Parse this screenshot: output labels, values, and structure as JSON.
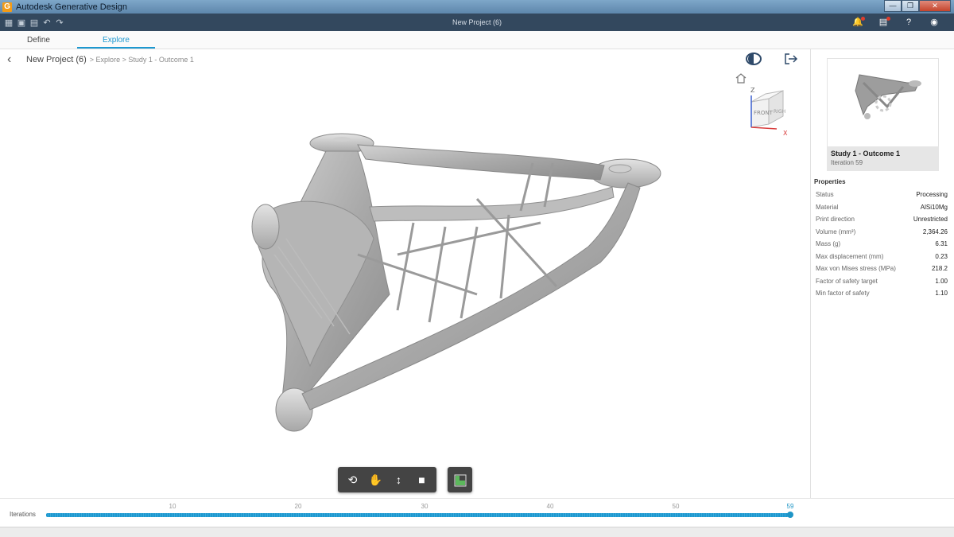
{
  "window": {
    "app_icon_letter": "G",
    "title": "Autodesk Generative Design",
    "minimize": "—",
    "maximize": "❐",
    "close": "✕"
  },
  "appbar": {
    "center_title": "New Project (6)",
    "tools": [
      "grid-icon",
      "save-icon",
      "save-as-icon",
      "undo-icon",
      "redo-icon"
    ],
    "right_icons": [
      "notifications-icon",
      "jobs-icon",
      "help-icon",
      "account-icon"
    ]
  },
  "tabs": [
    {
      "label": "Define",
      "active": false
    },
    {
      "label": "Explore",
      "active": true
    }
  ],
  "breadcrumb": {
    "project": "New Project (6)",
    "path": "> Explore > Study 1 - Outcome 1"
  },
  "viewcube": {
    "z": "Z",
    "x": "X",
    "front": "FRONT",
    "right": "RIGH"
  },
  "panel": {
    "outcome_title": "Study 1 - Outcome 1",
    "outcome_iteration": "Iteration 59",
    "properties_heading": "Properties",
    "properties": [
      {
        "label": "Status",
        "value": "Processing"
      },
      {
        "label": "Material",
        "value": "AlSi10Mg"
      },
      {
        "label": "Print direction",
        "value": "Unrestricted"
      },
      {
        "label": "Volume (mm³)",
        "value": "2,364.26"
      },
      {
        "label": "Mass (g)",
        "value": "6.31"
      },
      {
        "label": "Max displacement (mm)",
        "value": "0.23"
      },
      {
        "label": "Max von Mises stress (MPa)",
        "value": "218.2"
      },
      {
        "label": "Factor of safety target",
        "value": "1.00"
      },
      {
        "label": "Min factor of safety",
        "value": "1.10"
      }
    ]
  },
  "iterations": {
    "label": "Iterations",
    "ticks": [
      "10",
      "20",
      "30",
      "40",
      "50"
    ],
    "current": "59",
    "progress": 1.0
  },
  "colors": {
    "accent": "#1d98d0",
    "appbar": "#33485e",
    "toolbar": "#444444"
  }
}
